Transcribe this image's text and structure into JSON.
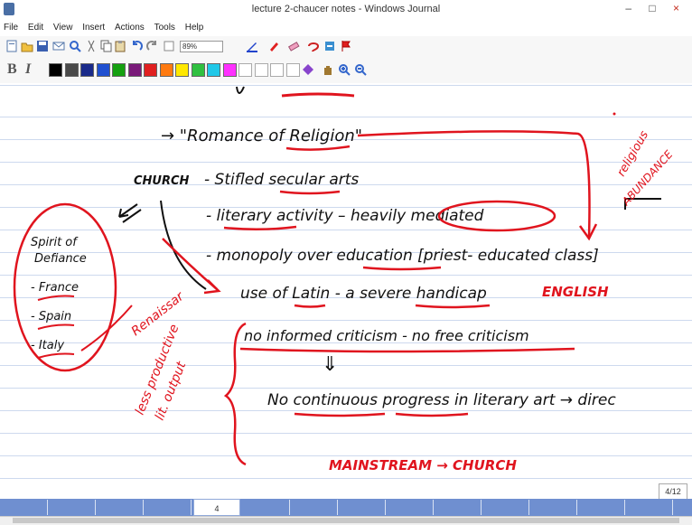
{
  "window": {
    "title": "lecture 2-chaucer notes - Windows Journal",
    "controls": [
      "–",
      "□",
      "×"
    ]
  },
  "menu": [
    "File",
    "Edit",
    "View",
    "Insert",
    "Actions",
    "Tools",
    "Help"
  ],
  "toolbar": {
    "zoom": "89%"
  },
  "format": {
    "bold": "B",
    "italic": "I"
  },
  "colors": {
    "ink_black": "#111111",
    "ink_red": "#e0141e",
    "rule_line": "#cdd9ee",
    "status_bar": "#6f8fd0"
  },
  "swatches": [
    "#000000",
    "#4a4a4a",
    "#1a2a8a",
    "#2050d0",
    "#15a010",
    "#7a1a7a",
    "#e02020",
    "#ff7a10",
    "#ffe800",
    "#30c040",
    "#20c8e8",
    "#ff30ff",
    "#ffffff",
    "#ffffff",
    "#ffffff",
    "#ffffff"
  ],
  "notes": {
    "romance": "→ \"Romance of Religion\"",
    "church_label": "CHURCH",
    "church_line": "- Stifled secular arts",
    "literary": "- literary activity – heavily mediated",
    "monopoly": "- monopoly over education [priest- educated class]",
    "latin": "use of Latin - a severe handicap",
    "criticism": "no informed criticism - no free criticism",
    "progress": "No continuous progress in literary art → direc",
    "spirit": [
      "Spirit of",
      "Defiance",
      "- France",
      "- Spain",
      "- Italy"
    ],
    "renaissance": "Renaissar",
    "less_productive": [
      "less productive",
      "lit. output"
    ],
    "religious": [
      "religious",
      "ABUNDANCE"
    ],
    "english": "ENGLISH",
    "mainstream": "MAINSTREAM → CHURCH",
    "down_arrow": "⇓"
  },
  "status": {
    "page_indicator": "4/12",
    "page_number": "4"
  }
}
